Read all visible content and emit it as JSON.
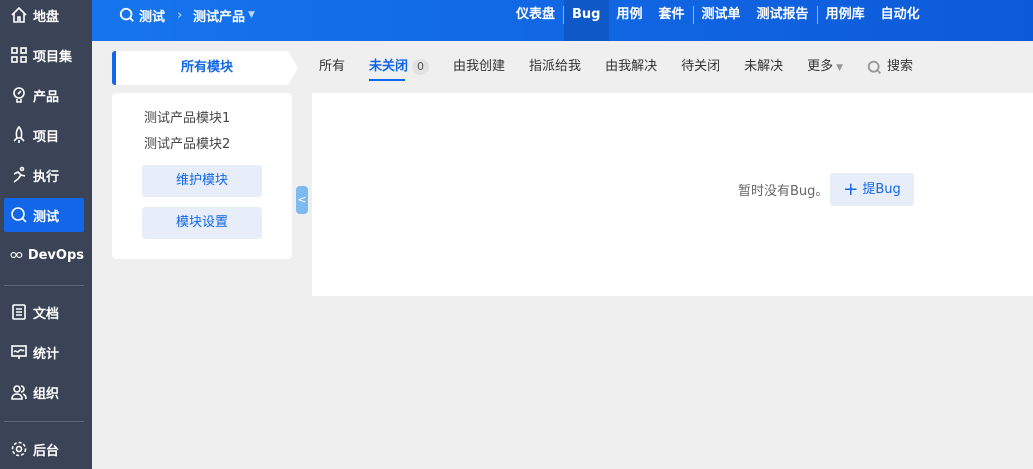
{
  "sidebar": {
    "items": [
      "地盘",
      "项目集",
      "产品",
      "项目",
      "执行",
      "测试",
      "DevOps",
      "文档",
      "统计",
      "组织",
      "后台"
    ]
  },
  "breadcrumb": {
    "module": "测试",
    "product": "测试产品"
  },
  "nav": {
    "items": [
      "仪表盘",
      "Bug",
      "用例",
      "套件",
      "测试单",
      "测试报告",
      "用例库",
      "自动化"
    ]
  },
  "modules": {
    "header": "所有模块",
    "items": [
      "测试产品模块1",
      "测试产品模块2"
    ],
    "maintain": "维护模块",
    "settings": "模块设置"
  },
  "tabs": {
    "all": "所有",
    "unclosed": "未关闭",
    "unclosed_count": "0",
    "created": "由我创建",
    "assigned": "指派给我",
    "resolved": "由我解决",
    "to_close": "待关闭",
    "unresolved": "未解决",
    "more": "更多",
    "search": "搜索"
  },
  "content": {
    "empty": "暂时没有Bug。",
    "add": "提Bug"
  }
}
